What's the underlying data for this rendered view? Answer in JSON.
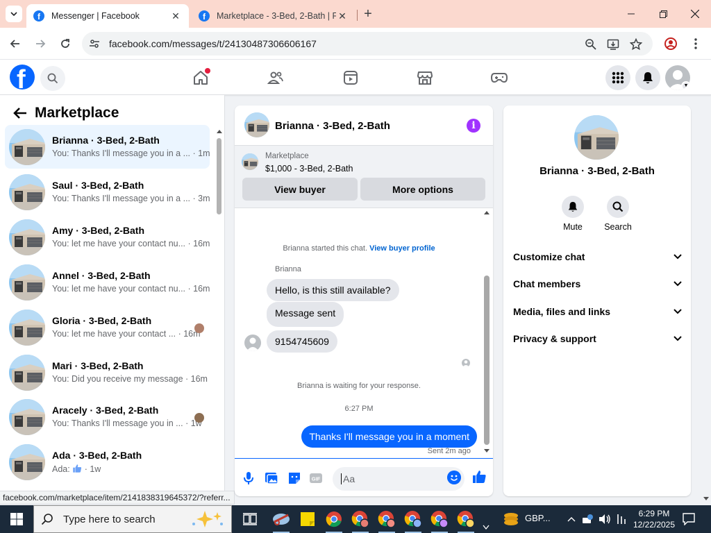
{
  "browser": {
    "tabs": [
      {
        "title": "Messenger | Facebook",
        "active": true
      },
      {
        "title": "Marketplace - 3-Bed, 2-Bath | F",
        "active": false
      }
    ],
    "url": "facebook.com/messages/t/24130487306606167",
    "status_url": "facebook.com/marketplace/item/2141838319645372/?referr..."
  },
  "fb": {
    "brand_color": "#0866ff",
    "logo_letter": "f"
  },
  "left": {
    "title": "Marketplace",
    "conversations": [
      {
        "name": "Brianna · 3-Bed, 2-Bath",
        "snippet": "You: Thanks I'll message you in a ... · 1m",
        "active": true
      },
      {
        "name": "Saul · 3-Bed, 2-Bath",
        "snippet": "You: Thanks I'll message you in a ... · 3m"
      },
      {
        "name": "Amy · 3-Bed, 2-Bath",
        "snippet": "You: let me have your contact nu... · 16m"
      },
      {
        "name": "Annel · 3-Bed, 2-Bath",
        "snippet": "You: let me have your contact nu... · 16m"
      },
      {
        "name": "Gloria · 3-Bed, 2-Bath",
        "snippet": "You: let me have your contact ... · 16m"
      },
      {
        "name": "Mari · 3-Bed, 2-Bath",
        "snippet": "You: Did you receive my message · 16m"
      },
      {
        "name": "Aracely · 3-Bed, 2-Bath",
        "snippet": "You: Thanks I'll message you in ... · 1w"
      },
      {
        "name": "Ada · 3-Bed, 2-Bath",
        "snippet_prefix": "Ada:",
        "snippet_suffix": "· 1w"
      }
    ]
  },
  "chat": {
    "title": "Brianna · 3-Bed, 2-Bath",
    "listing": {
      "category": "Marketplace",
      "price": "$1,000 - 3-Bed, 2-Bath"
    },
    "view_buyer": "View buyer",
    "more_options": "More options",
    "started": "Brianna started this chat.",
    "view_profile": "View buyer profile",
    "sender": "Brianna",
    "incoming": [
      "Hello, is this still available?",
      "Message sent",
      "9154745609"
    ],
    "waiting": "Brianna is waiting for your response.",
    "time": "6:27 PM",
    "outgoing": "Thanks I'll message you in a moment",
    "sent_status": "Sent 2m ago",
    "input_placeholder": "Aa"
  },
  "right": {
    "name": "Brianna · 3-Bed, 2-Bath",
    "mute": "Mute",
    "search": "Search",
    "sections": [
      "Customize chat",
      "Chat members",
      "Media, files and links",
      "Privacy & support"
    ]
  },
  "taskbar": {
    "search_placeholder": "Type here to search",
    "currency": "GBP...",
    "time": "6:29 PM",
    "date": "12/22/2025"
  }
}
